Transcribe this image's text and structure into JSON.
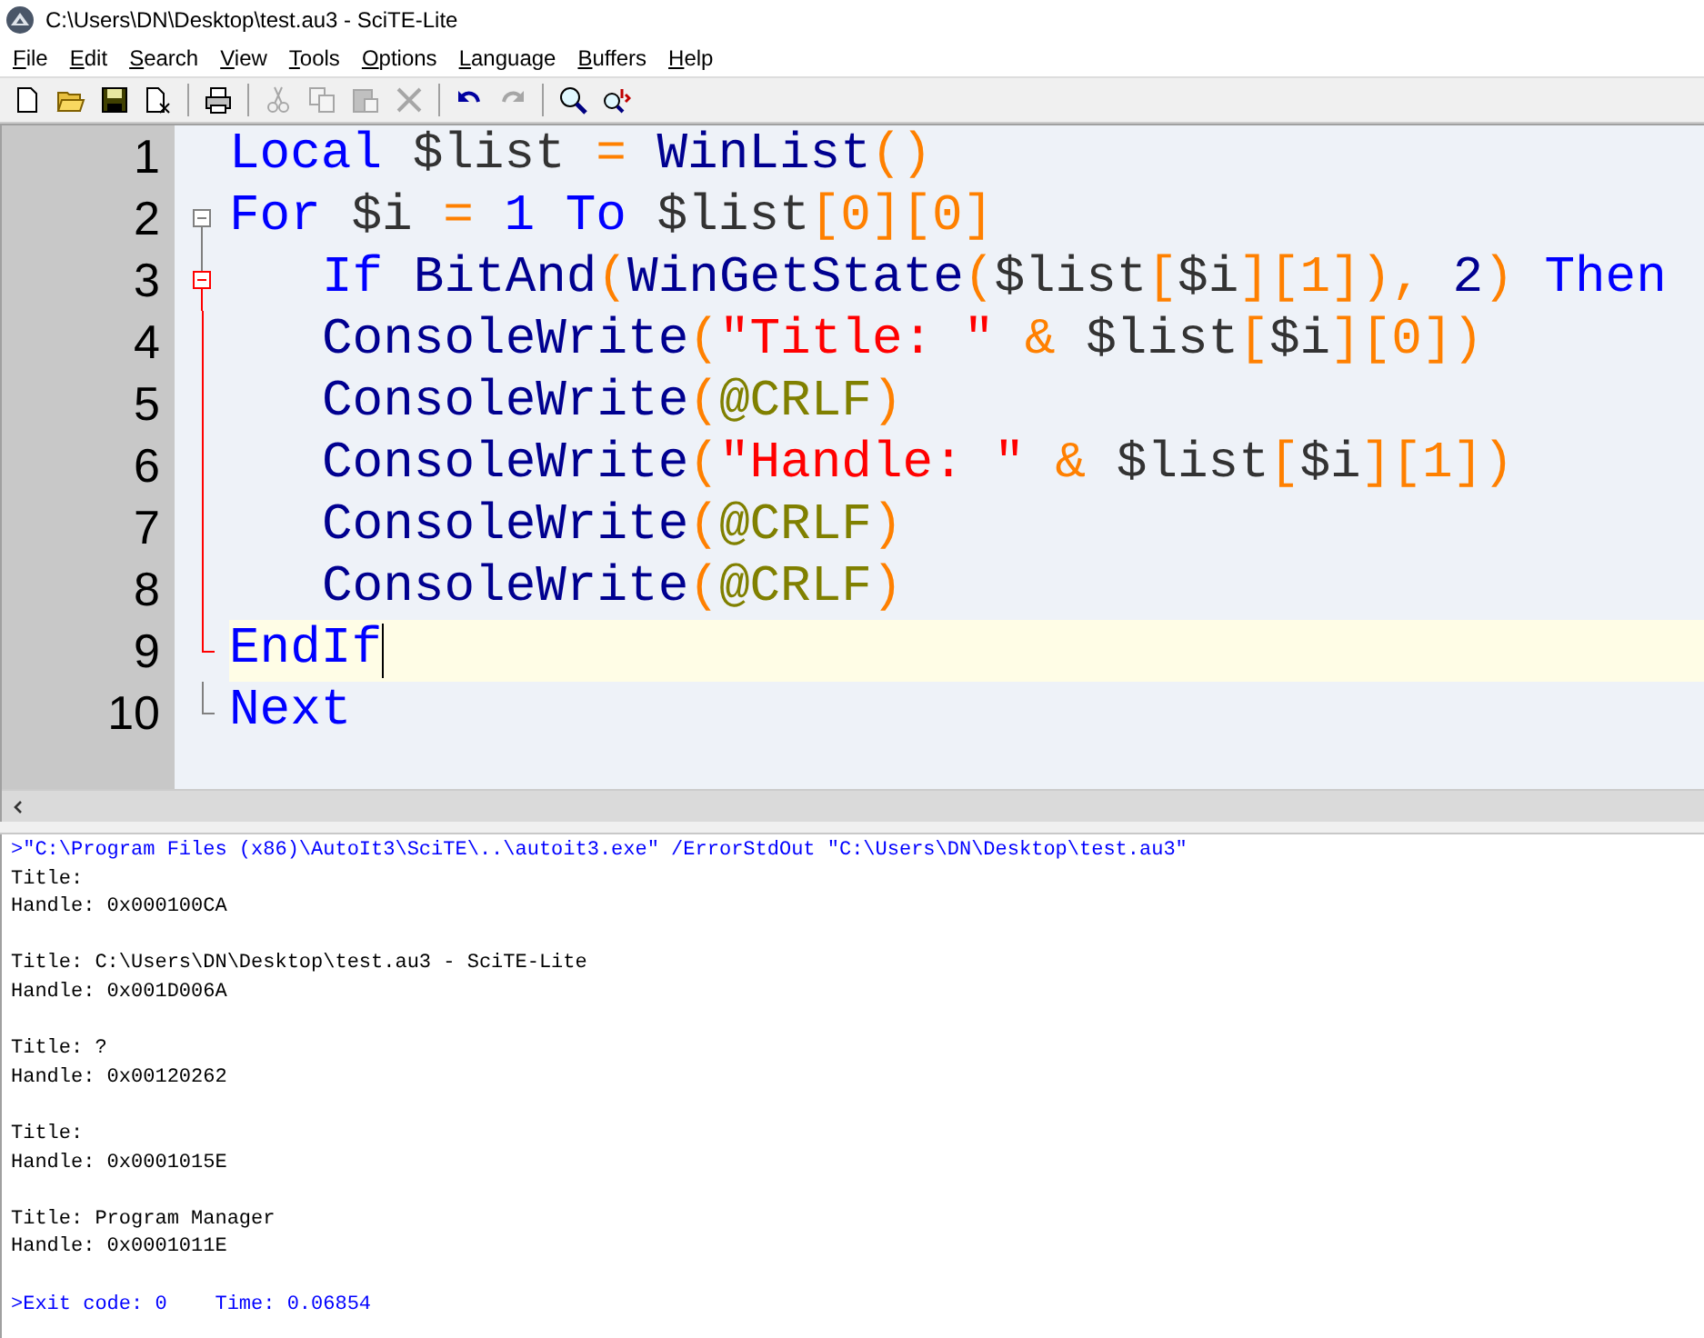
{
  "window": {
    "title": "C:\\Users\\DN\\Desktop\\test.au3 - SciTE-Lite"
  },
  "menu": [
    "File",
    "Edit",
    "Search",
    "View",
    "Tools",
    "Options",
    "Language",
    "Buffers",
    "Help"
  ],
  "toolbar": [
    {
      "kind": "new",
      "disabled": false
    },
    {
      "kind": "open",
      "disabled": false
    },
    {
      "kind": "save",
      "disabled": false
    },
    {
      "kind": "close",
      "disabled": false
    },
    {
      "kind": "separator"
    },
    {
      "kind": "print",
      "disabled": false
    },
    {
      "kind": "separator"
    },
    {
      "kind": "cut",
      "disabled": true
    },
    {
      "kind": "copy",
      "disabled": true
    },
    {
      "kind": "paste",
      "disabled": true
    },
    {
      "kind": "delete",
      "disabled": true
    },
    {
      "kind": "separator"
    },
    {
      "kind": "undo",
      "disabled": false
    },
    {
      "kind": "redo",
      "disabled": true
    },
    {
      "kind": "separator"
    },
    {
      "kind": "find",
      "disabled": false
    },
    {
      "kind": "replace",
      "disabled": false
    }
  ],
  "editor": {
    "lines": [
      {
        "number": "1",
        "indented": false,
        "current": false,
        "tokens": [
          {
            "kind": "keyword",
            "text": "Local"
          },
          {
            "kind": "variable",
            "text": " $list "
          },
          {
            "kind": "operator",
            "text": "="
          },
          {
            "kind": "function",
            "text": " WinList"
          },
          {
            "kind": "operator",
            "text": "()"
          }
        ]
      },
      {
        "number": "2",
        "indented": false,
        "fold": {
          "kind": "head",
          "active": false
        },
        "current": false,
        "tokens": [
          {
            "kind": "keyword",
            "text": "For"
          },
          {
            "kind": "variable",
            "text": " $i "
          },
          {
            "kind": "operator",
            "text": "="
          },
          {
            "kind": "number",
            "text": " 1 "
          },
          {
            "kind": "keyword",
            "text": "To"
          },
          {
            "kind": "variable",
            "text": " $list"
          },
          {
            "kind": "operator",
            "text": "[0][0]"
          }
        ]
      },
      {
        "number": "3",
        "indented": true,
        "fold": {
          "kind": "head",
          "active": true
        },
        "current": false,
        "tokens": [
          {
            "kind": "keyword",
            "text": "If"
          },
          {
            "kind": "function",
            "text": " BitAnd"
          },
          {
            "kind": "operator",
            "text": "("
          },
          {
            "kind": "function",
            "text": "WinGetState"
          },
          {
            "kind": "operator",
            "text": "("
          },
          {
            "kind": "variable",
            "text": "$list"
          },
          {
            "kind": "operator",
            "text": "["
          },
          {
            "kind": "variable",
            "text": "$i"
          },
          {
            "kind": "operator",
            "text": "][1]),"
          },
          {
            "kind": "function",
            "text": " 2"
          },
          {
            "kind": "operator",
            "text": ")"
          },
          {
            "kind": "keyword",
            "text": " Then"
          }
        ]
      },
      {
        "number": "4",
        "indented": true,
        "fold": {
          "kind": "body",
          "active": true
        },
        "current": false,
        "tokens": [
          {
            "kind": "function",
            "text": "ConsoleWrite"
          },
          {
            "kind": "operator",
            "text": "("
          },
          {
            "kind": "string",
            "text": "\"Title: \""
          },
          {
            "kind": "operator",
            "text": " &"
          },
          {
            "kind": "variable",
            "text": " $list"
          },
          {
            "kind": "operator",
            "text": "["
          },
          {
            "kind": "variable",
            "text": "$i"
          },
          {
            "kind": "operator",
            "text": "][0])"
          }
        ]
      },
      {
        "number": "5",
        "indented": true,
        "fold": {
          "kind": "body",
          "active": true
        },
        "current": false,
        "tokens": [
          {
            "kind": "function",
            "text": "ConsoleWrite"
          },
          {
            "kind": "operator",
            "text": "("
          },
          {
            "kind": "macro",
            "text": "@CRLF"
          },
          {
            "kind": "operator",
            "text": ")"
          }
        ]
      },
      {
        "number": "6",
        "indented": true,
        "fold": {
          "kind": "body",
          "active": true
        },
        "current": false,
        "tokens": [
          {
            "kind": "function",
            "text": "ConsoleWrite"
          },
          {
            "kind": "operator",
            "text": "("
          },
          {
            "kind": "string",
            "text": "\"Handle: \""
          },
          {
            "kind": "operator",
            "text": " &"
          },
          {
            "kind": "variable",
            "text": " $list"
          },
          {
            "kind": "operator",
            "text": "["
          },
          {
            "kind": "variable",
            "text": "$i"
          },
          {
            "kind": "operator",
            "text": "][1])"
          }
        ]
      },
      {
        "number": "7",
        "indented": true,
        "fold": {
          "kind": "body",
          "active": true
        },
        "current": false,
        "tokens": [
          {
            "kind": "function",
            "text": "ConsoleWrite"
          },
          {
            "kind": "operator",
            "text": "("
          },
          {
            "kind": "macro",
            "text": "@CRLF"
          },
          {
            "kind": "operator",
            "text": ")"
          }
        ]
      },
      {
        "number": "8",
        "indented": true,
        "fold": {
          "kind": "body",
          "active": true
        },
        "current": false,
        "tokens": [
          {
            "kind": "function",
            "text": "ConsoleWrite"
          },
          {
            "kind": "operator",
            "text": "("
          },
          {
            "kind": "macro",
            "text": "@CRLF"
          },
          {
            "kind": "operator",
            "text": ")"
          }
        ]
      },
      {
        "number": "9",
        "indented": false,
        "fold": {
          "kind": "end",
          "active": true
        },
        "current": true,
        "tokens": [
          {
            "kind": "keyword",
            "text": "EndIf"
          }
        ]
      },
      {
        "number": "10",
        "indented": false,
        "fold": {
          "kind": "end",
          "active": false
        },
        "current": false,
        "tokens": [
          {
            "kind": "keyword",
            "text": "Next"
          }
        ]
      }
    ]
  },
  "output": [
    {
      "kind": "command",
      "text": ">\"C:\\Program Files (x86)\\AutoIt3\\SciTE\\..\\autoit3.exe\" /ErrorStdOut \"C:\\Users\\DN\\Desktop\\test.au3\""
    },
    {
      "kind": "text",
      "text": "Title:"
    },
    {
      "kind": "text",
      "text": "Handle: 0x000100CA"
    },
    {
      "kind": "blank"
    },
    {
      "kind": "text",
      "text": "Title: C:\\Users\\DN\\Desktop\\test.au3 - SciTE-Lite"
    },
    {
      "kind": "text",
      "text": "Handle: 0x001D006A"
    },
    {
      "kind": "blank"
    },
    {
      "kind": "text",
      "text": "Title: ?"
    },
    {
      "kind": "text",
      "text": "Handle: 0x00120262"
    },
    {
      "kind": "blank"
    },
    {
      "kind": "text",
      "text": "Title:"
    },
    {
      "kind": "text",
      "text": "Handle: 0x0001015E"
    },
    {
      "kind": "blank"
    },
    {
      "kind": "text",
      "text": "Title: Program Manager"
    },
    {
      "kind": "text",
      "text": "Handle: 0x0001011E"
    },
    {
      "kind": "blank"
    },
    {
      "kind": "command",
      "text": ">Exit code: 0    Time: 0.06854"
    }
  ]
}
